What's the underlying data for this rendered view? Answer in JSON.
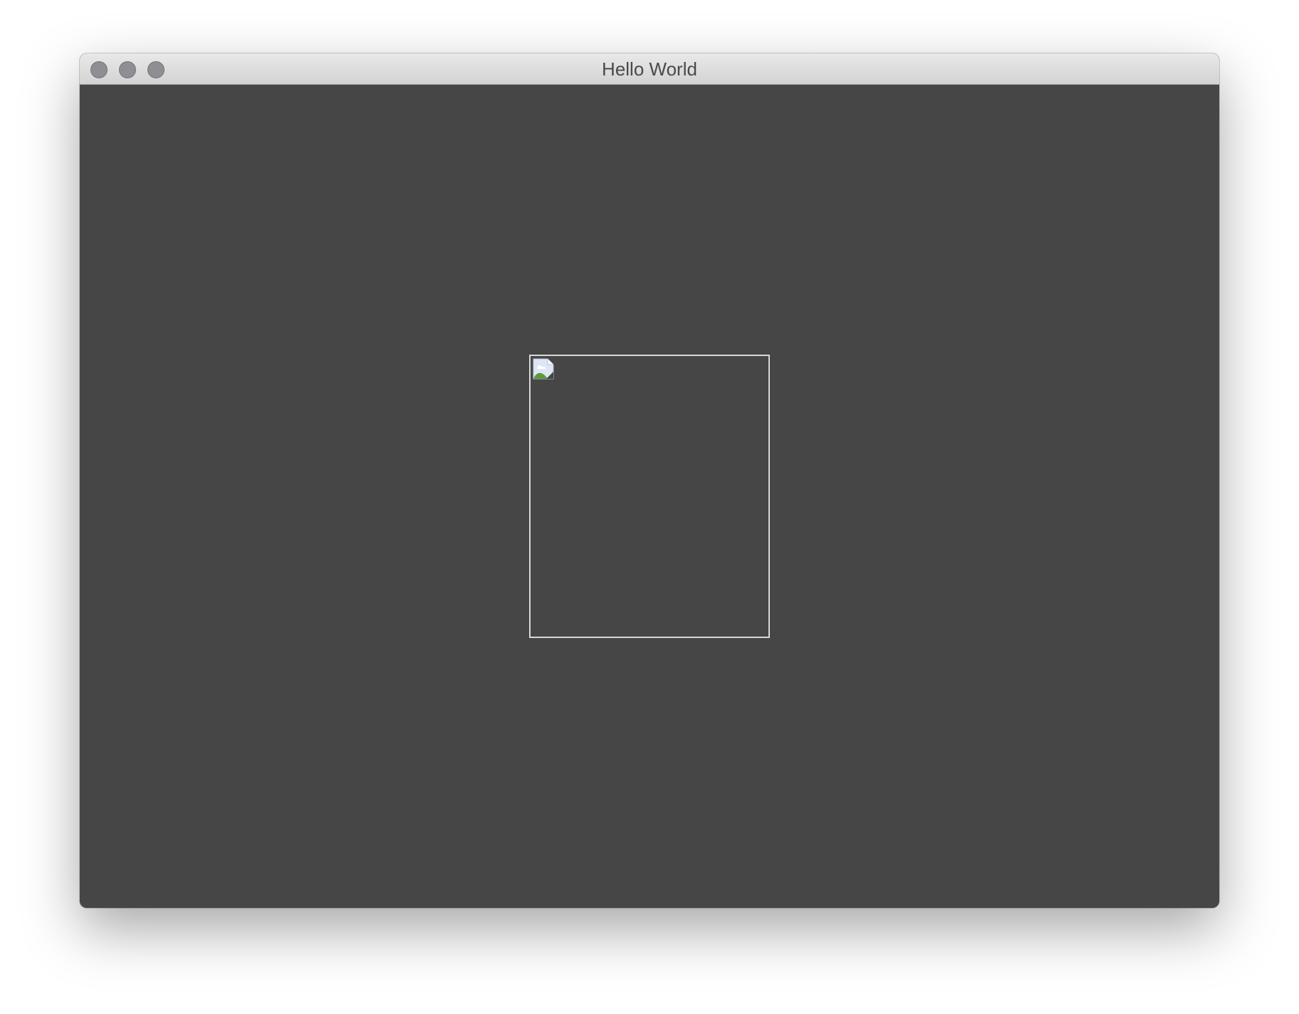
{
  "window": {
    "title": "Hello World",
    "background_color": "#464646",
    "titlebar_buttons": [
      "close",
      "minimize",
      "zoom"
    ]
  },
  "content": {
    "image": {
      "state": "broken",
      "icon": "broken-image-icon",
      "border_color": "#d8d8d8"
    }
  }
}
